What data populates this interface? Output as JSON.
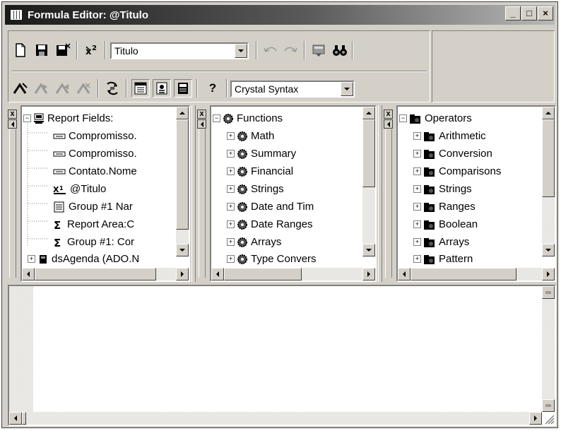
{
  "window": {
    "title": "Formula Editor: @Titulo",
    "minimize_glyph": "_",
    "maximize_glyph": "□",
    "close_glyph": "×"
  },
  "toolbar": {
    "formula_name": "Titulo",
    "syntax": "Crystal Syntax",
    "help_label": "?",
    "icons": [
      "new-icon",
      "save-icon",
      "save-close-icon",
      "x2-icon",
      "undo-icon",
      "redo-icon",
      "bookmark-icon",
      "find-icon",
      "add-bookmark-icon",
      "next-bookmark-icon",
      "prev-bookmark-icon",
      "clear-bookmarks-icon",
      "check-icon",
      "fields-tree-icon",
      "functions-tree-icon",
      "operators-tree-icon",
      "help-icon"
    ]
  },
  "panes": {
    "close_glyph": "x",
    "fields": {
      "root": "Report Fields:",
      "items": [
        "Compromisso.",
        "Compromisso.",
        "Contato.Nome",
        "@Titulo",
        "Group #1 Nar",
        "Report Area:C",
        "Group #1: Cor",
        "dsAgenda (ADO.N"
      ]
    },
    "functions": {
      "root": "Functions",
      "items": [
        "Math",
        "Summary",
        "Financial",
        "Strings",
        "Date and Tim",
        "Date Ranges",
        "Arrays",
        "Type Convers"
      ]
    },
    "operators": {
      "root": "Operators",
      "items": [
        "Arithmetic",
        "Conversion",
        "Comparisons",
        "Strings",
        "Ranges",
        "Boolean",
        "Arrays",
        "Pattern"
      ]
    }
  },
  "editor": {
    "text": ""
  },
  "colors": {
    "face": "#d4d0c8",
    "title_start": "#1a1a1a",
    "title_end": "#b8b8b8"
  }
}
